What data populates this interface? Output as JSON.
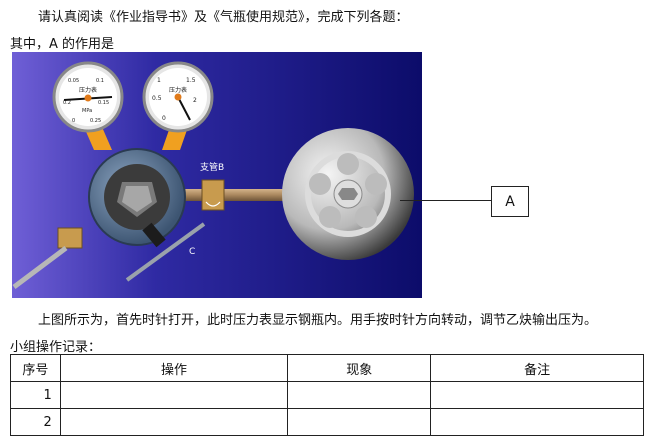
{
  "instructions": "请认真阅读《作业指导书》及《气瓶使用规范》，完成下列各题：",
  "question": "其中，A 的作用是",
  "figure": {
    "gauge_left_label": "压力表",
    "gauge_left_unit": "MPa",
    "gauge_left_ticks": [
      "0.05",
      "0.1",
      "0.15",
      "0.2",
      "0.25",
      "0"
    ],
    "gauge_right_label": "压力表",
    "gauge_right_ticks": [
      "1.5",
      "2",
      "0.5",
      "1",
      "0"
    ],
    "branch_label": "支管B",
    "label_c": "C",
    "callout_label": "A",
    "colors": {
      "background": "#1e1e8c",
      "accent": "#f0a020",
      "needle": "#111111"
    }
  },
  "description": "上图所示为，首先时针打开，此时压力表显示钢瓶内。用手按时针方向转动，调节乙炔输出压为。",
  "record_title": "小组操作记录：",
  "table": {
    "headers": [
      "序号",
      "操作",
      "现象",
      "备注"
    ],
    "rows": [
      [
        "1",
        "",
        "",
        ""
      ],
      [
        "2",
        "",
        "",
        ""
      ]
    ]
  }
}
